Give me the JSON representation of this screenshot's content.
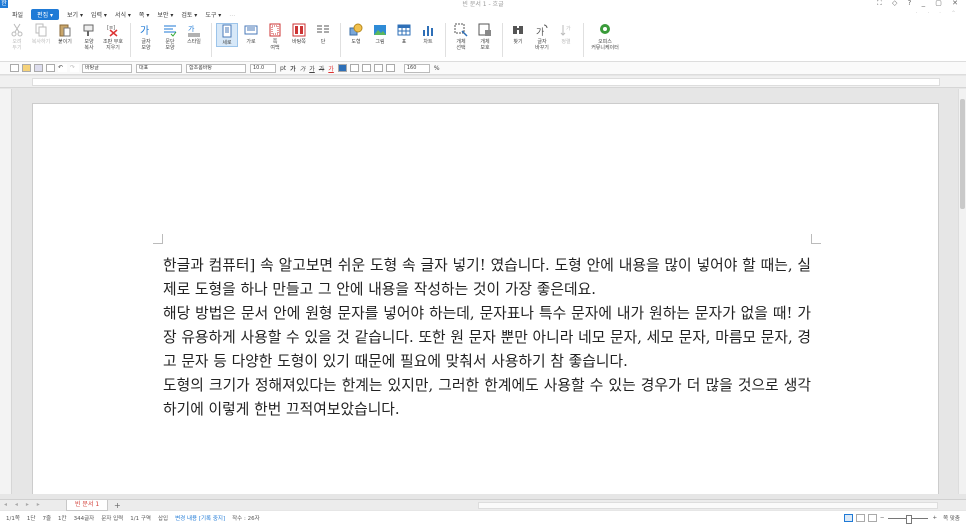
{
  "window": {
    "title": "빈 문서 1 - 흐글",
    "app_icon": "한",
    "controls": "⛶ ◇ ? _ ▢ ✕"
  },
  "menu": {
    "items": [
      "파일",
      "편집 ▾",
      "보기 ▾",
      "입력 ▾",
      "서식 ▾",
      "쪽 ▾",
      "보안 ▾",
      "검토 ▾",
      "도구 ▾",
      "…"
    ],
    "active_index": 1,
    "right": "· · · ⌃"
  },
  "ribbon": {
    "buttons": [
      {
        "label": "오려\n두기",
        "icon": "scissors-icon",
        "dim": true
      },
      {
        "label": "복사하기",
        "icon": "copy-icon",
        "dim": true
      },
      {
        "label": "붙이기",
        "icon": "paste-icon"
      },
      {
        "label": "모양\n복사",
        "icon": "format-painter-icon"
      },
      {
        "label": "조판 부호\n지우기",
        "icon": "clear-format-icon"
      },
      {
        "label": "글자\n모양",
        "icon": "char-shape-icon"
      },
      {
        "label": "문단\n모양",
        "icon": "para-shape-icon"
      },
      {
        "label": "스타일",
        "icon": "style-icon"
      },
      {
        "label": "세로",
        "icon": "portrait-icon",
        "selected": true
      },
      {
        "label": "가로",
        "icon": "landscape-icon"
      },
      {
        "label": "쪽\n여백",
        "icon": "margin-icon"
      },
      {
        "label": "바탕쪽",
        "icon": "master-page-icon"
      },
      {
        "label": "단",
        "icon": "columns-icon"
      },
      {
        "label": "도형",
        "icon": "shape-icon"
      },
      {
        "label": "그림",
        "icon": "picture-icon"
      },
      {
        "label": "표",
        "icon": "table-icon"
      },
      {
        "label": "차트",
        "icon": "chart-icon"
      },
      {
        "label": "개체\n선택",
        "icon": "select-object-icon"
      },
      {
        "label": "개체\n보호",
        "icon": "protect-object-icon"
      },
      {
        "label": "찾기",
        "icon": "find-icon"
      },
      {
        "label": "글자\n바꾸기",
        "icon": "replace-icon"
      },
      {
        "label": "정렬",
        "icon": "sort-icon",
        "dim": true
      },
      {
        "label": "오피스\n커뮤니케이터",
        "icon": "communicator-icon",
        "wide": true
      }
    ]
  },
  "format_toolbar": {
    "style": "바탕글",
    "lang": "대표",
    "font": "함초롬바탕",
    "size": "10.0",
    "size_unit": "pt",
    "bold_label": "가",
    "italic_label": "가",
    "underline_label": "가",
    "strike_label": "가",
    "color_label": "가",
    "line_spacing": "160",
    "line_spacing_unit": "%"
  },
  "document": {
    "paragraphs": [
      "한글과 컴퓨터] 속 알고보면 쉬운 도형 속 글자 넣기! 였습니다. 도형 안에 내용을 많이 넣어야 할 때는, 실제로 도형을 하나 만들고 그 안에 내용을 작성하는 것이 가장 좋은데요.",
      "해당 방법은 문서 안에 원형  문자를 넣어야 하는데, 문자표나 특수 문자에 내가 원하는 문자가 없을 때! 가장 유용하게 사용할 수 있을 것 같습니다. 또한 원 문자 뿐만 아니라 네모 문자, 세모 문자, 마름모 문자, 경고 문자 등 다양한 도형이 있기 때문에 필요에 맞춰서 사용하기 참 좋습니다.",
      "도형의 크기가 정해져있다는 한계는 있지만, 그러한 한계에도 사용할 수 있는 경우가 더 많을 것으로 생각하기에 이렇게 한번 끄적여보았습니다."
    ]
  },
  "tabs": {
    "nav": "◂ ◂ ▸ ▸",
    "active": "빈 문서 1",
    "add": "+"
  },
  "status": {
    "page": "1/1쪽",
    "section": "1단",
    "line": "7줄",
    "col": "1칸",
    "chars": "344글자",
    "mode": "문자 입력",
    "area": "1/1 구역",
    "insert": "삽입",
    "track": "변경 내용 [기록 중지]",
    "pages_total": "작수 : 26자",
    "zoom_label": "쪽 맞춤"
  }
}
